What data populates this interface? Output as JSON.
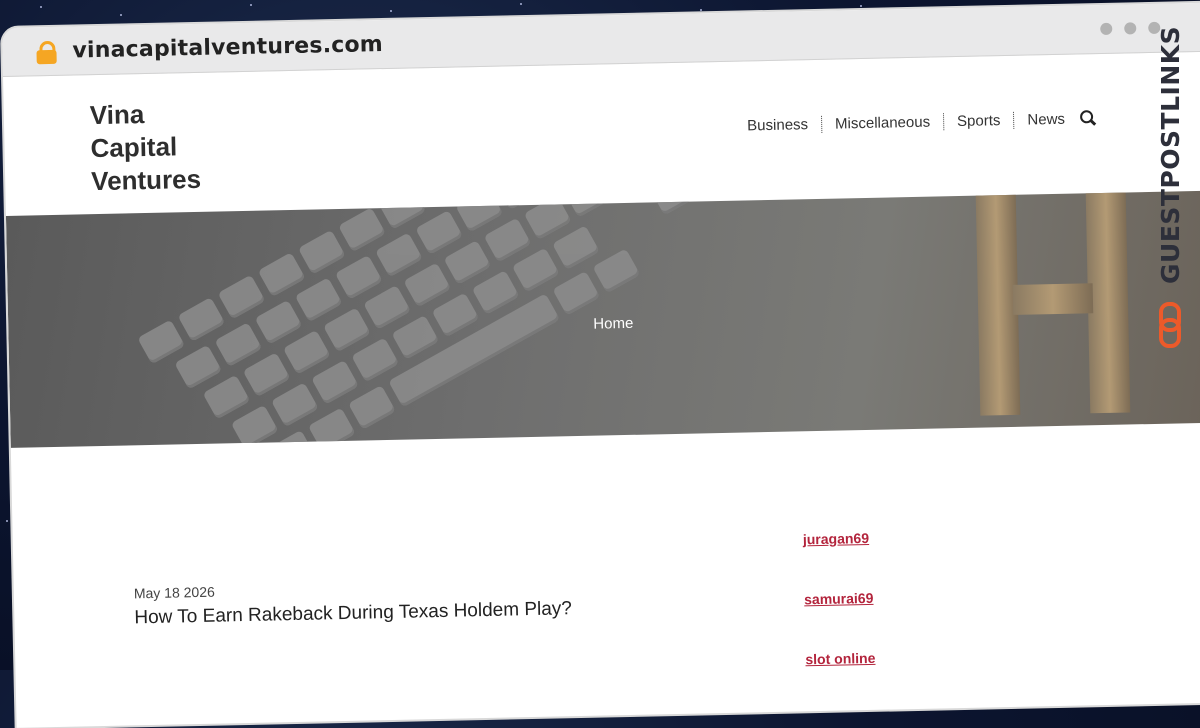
{
  "browser": {
    "url": "vinacapitalventures.com"
  },
  "site": {
    "logo_lines": [
      "Vina",
      "Capital",
      "Ventures"
    ]
  },
  "nav": {
    "items": [
      "Business",
      "Miscellaneous",
      "Sports",
      "News"
    ]
  },
  "hero": {
    "title": "Home"
  },
  "badge": {
    "text": "GUESTPOSTLINKS"
  },
  "post": {
    "date": "May 18 2026",
    "title": "How To Earn Rakeback During Texas Holdem Play?"
  },
  "sidebar": {
    "links": [
      "juragan69",
      "samurai69",
      "slot online"
    ]
  },
  "colors": {
    "link": "#b3243c",
    "badge_icon": "#ec5a2a",
    "lock": "#f5a623"
  }
}
